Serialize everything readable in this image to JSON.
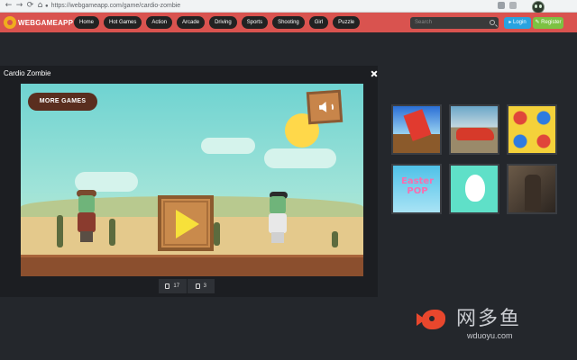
{
  "browser": {
    "back": "←",
    "forward": "→",
    "reload": "⟳",
    "home": "⌂",
    "url": "https://webgameapp.com/game/cardio-zombie"
  },
  "header": {
    "logo_text": "WEBGAMEAPP",
    "nav": [
      "Home",
      "Hot Games",
      "Action",
      "Arcade",
      "Driving",
      "Sports",
      "Shooting",
      "Girl",
      "Puzzle"
    ],
    "search_placeholder": "Search",
    "login_label": "Login",
    "register_label": "Register"
  },
  "game": {
    "title": "Cardio Zombie",
    "more_games_label": "MORE GAMES"
  },
  "votes": {
    "likes": "17",
    "dislikes": "3"
  },
  "related": {
    "easter_line1": "Easter",
    "easter_line2": "POP"
  },
  "watermark": {
    "cn": "网多鱼",
    "en": "wduoyu.com"
  },
  "colors": {
    "header_red": "#d9534f",
    "login_blue": "#29a3e0",
    "register_green": "#7cc242",
    "page_bg": "#24272c"
  }
}
